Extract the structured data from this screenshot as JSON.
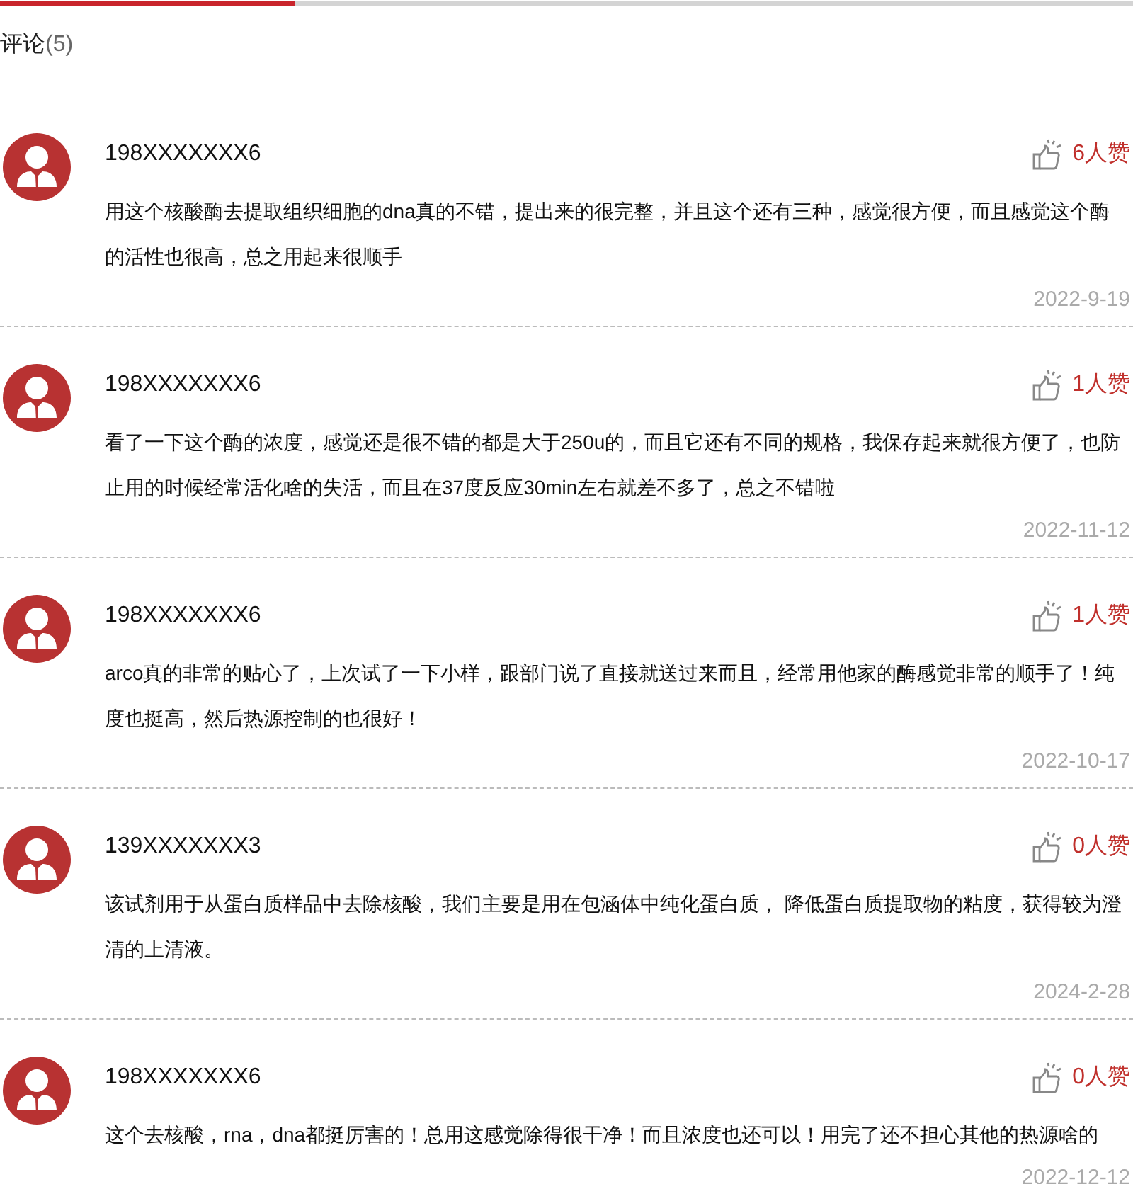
{
  "section": {
    "title": "评论",
    "count": "(5)"
  },
  "comments": [
    {
      "user": "198XXXXXXX6",
      "likes": "6人赞",
      "text": "用这个核酸酶去提取组织细胞的dna真的不错，提出来的很完整，并且这个还有三种，感觉很方便，而且感觉这个酶的活性也很高，总之用起来很顺手",
      "date": "2022-9-19"
    },
    {
      "user": "198XXXXXXX6",
      "likes": "1人赞",
      "text": "看了一下这个酶的浓度，感觉还是很不错的都是大于250u的，而且它还有不同的规格，我保存起来就很方便了，也防止用的时候经常活化啥的失活，而且在37度反应30min左右就差不多了，总之不错啦",
      "date": "2022-11-12"
    },
    {
      "user": "198XXXXXXX6",
      "likes": "1人赞",
      "text": "arco真的非常的贴心了，上次试了一下小样，跟部门说了直接就送过来而且，经常用他家的酶感觉非常的顺手了！纯度也挺高，然后热源控制的也很好！",
      "date": "2022-10-17"
    },
    {
      "user": "139XXXXXXX3",
      "likes": "0人赞",
      "text": "该试剂用于从蛋白质样品中去除核酸，我们主要是用在包涵体中纯化蛋白质， 降低蛋白质提取物的粘度，获得较为澄清的上清液。",
      "date": "2024-2-28"
    },
    {
      "user": "198XXXXXXX6",
      "likes": "0人赞",
      "text": "这个去核酸，rna，dna都挺厉害的！总用这感觉除得很干净！而且浓度也还可以！用完了还不担心其他的热源啥的",
      "date": "2022-12-12"
    }
  ]
}
